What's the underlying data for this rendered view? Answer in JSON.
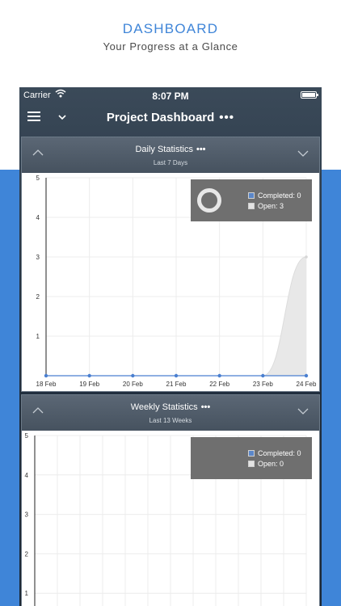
{
  "promo": {
    "title": "DASHBOARD",
    "subtitle": "Your Progress at a Glance"
  },
  "status_bar": {
    "carrier": "Carrier",
    "time": "8:07 PM"
  },
  "navbar": {
    "title": "Project Dashboard",
    "more": "•••"
  },
  "daily": {
    "title": "Daily Statistics",
    "more": "•••",
    "subtitle": "Last 7 Days",
    "legend": {
      "completed": "Completed: 0",
      "open": "Open: 3"
    }
  },
  "weekly": {
    "title": "Weekly Statistics",
    "more": "•••",
    "subtitle": "Last 13 Weeks",
    "legend": {
      "completed": "Completed: 0",
      "open": "Open: 0"
    }
  },
  "colors": {
    "accent_blue": "#3f85d8",
    "completed": "#5b87c9",
    "open": "#e3e3e3",
    "line_blue": "#4a7fd0"
  },
  "chart_data": [
    {
      "type": "area",
      "title": "Daily Statistics",
      "subtitle": "Last 7 Days",
      "x": [
        "18 Feb",
        "19 Feb",
        "20 Feb",
        "21 Feb",
        "22 Feb",
        "23 Feb",
        "24 Feb"
      ],
      "series": [
        {
          "name": "Completed",
          "values": [
            0,
            0,
            0,
            0,
            0,
            0,
            0
          ]
        },
        {
          "name": "Open",
          "values": [
            0,
            0,
            0,
            0,
            0,
            0,
            3
          ]
        }
      ],
      "ylim": [
        0,
        5
      ],
      "yticks": [
        "1",
        "2",
        "3",
        "4",
        "5"
      ],
      "grid": true,
      "legend_position": "top-right"
    },
    {
      "type": "area",
      "title": "Weekly Statistics",
      "subtitle": "Last 13 Weeks",
      "series": [
        {
          "name": "Completed",
          "values": []
        },
        {
          "name": "Open",
          "values": []
        }
      ],
      "ylim": [
        0,
        5
      ],
      "yticks": [
        "1",
        "2",
        "3",
        "4",
        "5"
      ],
      "grid": true,
      "legend_position": "top-right"
    }
  ]
}
